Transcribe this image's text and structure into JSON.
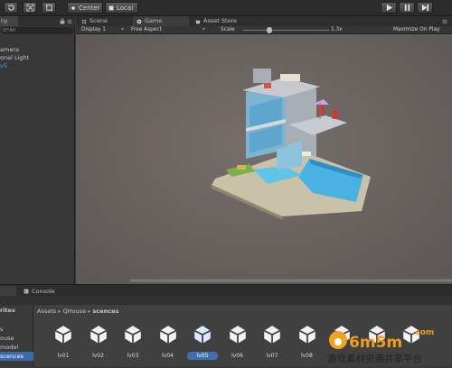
{
  "toolbar": {
    "pivot_label": "Center",
    "space_label": "Local",
    "tools": [
      "refresh-tool",
      "scale-tool",
      "rect-tool"
    ],
    "play_icons": [
      "play-icon",
      "pause-icon",
      "step-icon"
    ]
  },
  "hierarchy": {
    "tab_label": "ny",
    "search_placeholder": "Q*All",
    "items": [
      {
        "label": "amera"
      },
      {
        "label": "onal Light"
      },
      {
        "label": "v5"
      }
    ]
  },
  "view_tabs": [
    {
      "label": "Scene",
      "icon": "hash-icon"
    },
    {
      "label": "Game",
      "icon": "game-icon"
    },
    {
      "label": "Asset Store",
      "icon": "store-icon"
    }
  ],
  "game_toolbar": {
    "display": "Display 1",
    "aspect": "Free Aspect",
    "scale_label": "Scale",
    "scale_value": "1.3x",
    "maximize": "Maximize On Play",
    "scale_level": 0.3
  },
  "bottom_tabs": [
    {
      "label": "",
      "icon": "project-icon"
    },
    {
      "label": "Console",
      "icon": "console-icon"
    }
  ],
  "favorites": {
    "header": "rites",
    "items": [
      {
        "label": "s"
      },
      {
        "label": "ouse"
      },
      {
        "label": "model"
      },
      {
        "label": "scences"
      }
    ]
  },
  "breadcrumb": {
    "root": "Assets",
    "mid": "QHouse",
    "current": "scences"
  },
  "assets": [
    {
      "label": "lv01",
      "selected": false
    },
    {
      "label": "lv02",
      "selected": false
    },
    {
      "label": "lv03",
      "selected": false
    },
    {
      "label": "lv04",
      "selected": false
    },
    {
      "label": "lv05",
      "selected": true
    },
    {
      "label": "lv06",
      "selected": false
    },
    {
      "label": "lv07",
      "selected": false
    },
    {
      "label": "lv08",
      "selected": false
    },
    {
      "label": "",
      "selected": false
    },
    {
      "label": "",
      "selected": false
    },
    {
      "label": "",
      "selected": false
    }
  ],
  "watermark": {
    "brand": "6m5m",
    "tld": ".com",
    "caption": "游戏素材资源共享平台"
  },
  "colors": {
    "accent": "#3d6fb2",
    "game_bg": "#6f6967",
    "link_blue": "#4f9bff"
  }
}
